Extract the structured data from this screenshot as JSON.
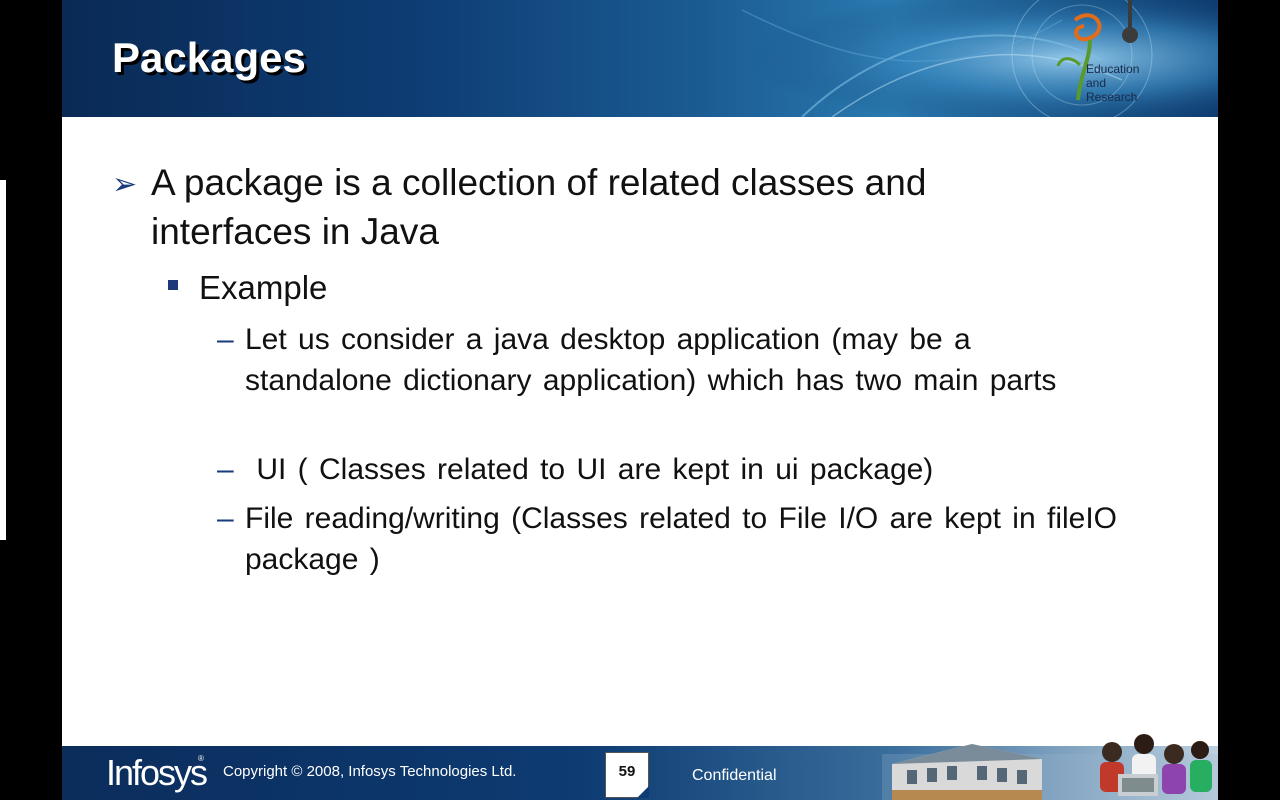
{
  "slide": {
    "title": "Packages",
    "logo": {
      "line1": "Education",
      "line2": "and",
      "line3": "Research"
    },
    "points": {
      "l1": "A package is a collection of related classes and interfaces in Java",
      "l2": "Example",
      "l3": [
        "Let us consider a java desktop application (may be a standalone dictionary application) which has two main parts",
        " UI ( Classes related to UI are kept in ui package)",
        "File reading/writing (Classes related to File I/O are kept in fileIO package )"
      ]
    }
  },
  "footer": {
    "brand": "Infosys",
    "registered": "®",
    "copyright": "Copyright © 2008, Infosys Technologies Ltd.",
    "page_number": "59",
    "confidential": "Confidential"
  },
  "colors": {
    "header_dark": "#0a2a55",
    "header_light": "#2a7ab0",
    "bullet_blue": "#1a3a7a",
    "logo_orange": "#e36c1b",
    "logo_green": "#5a9a2c"
  },
  "icons": {
    "l1_bullet": "arrowhead-bullet",
    "l2_bullet": "square-bullet",
    "l3_bullet": "dash-bullet"
  }
}
